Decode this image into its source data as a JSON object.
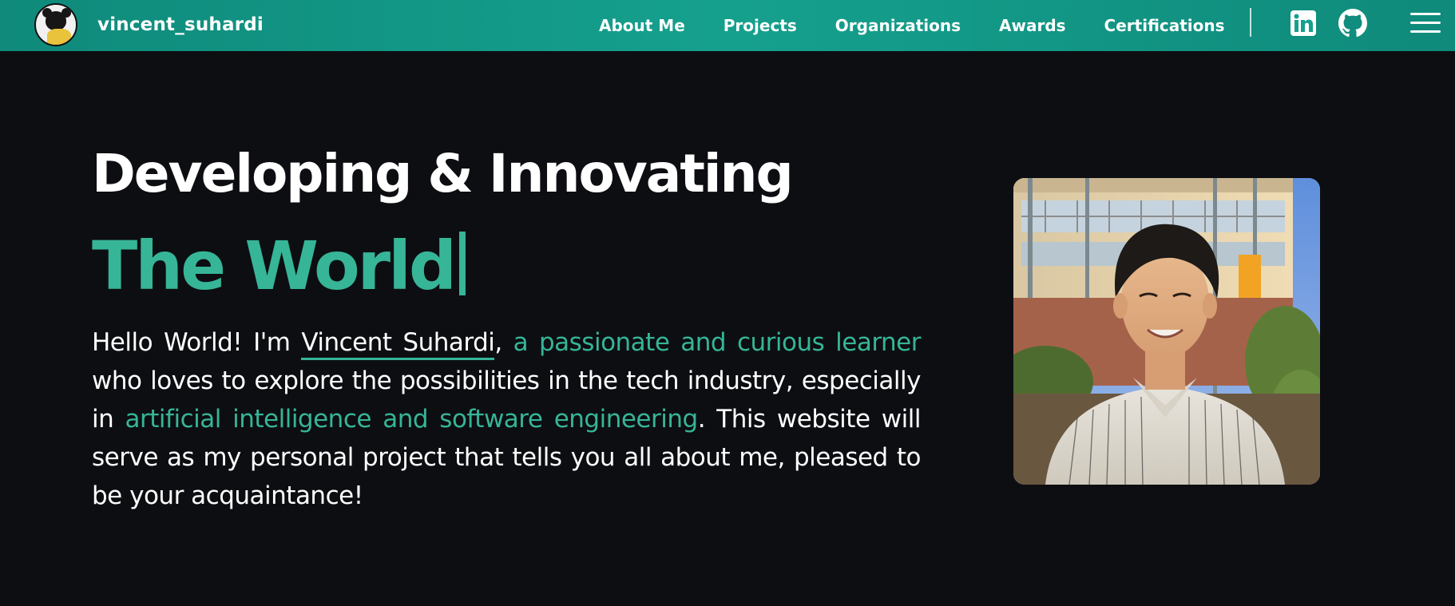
{
  "brand": {
    "name": "vincent_suhardi",
    "avatar_icon": "panda-avatar-icon"
  },
  "nav": {
    "links": [
      {
        "label": "About Me"
      },
      {
        "label": "Projects"
      },
      {
        "label": "Organizations"
      },
      {
        "label": "Awards"
      },
      {
        "label": "Certifications"
      }
    ],
    "social": {
      "linkedin_icon": "linkedin-icon",
      "github_icon": "github-icon"
    },
    "menu_icon": "hamburger-menu-icon"
  },
  "hero": {
    "title_line1": "Developing & Innovating",
    "title_line2": "The World",
    "intro": {
      "greeting": "Hello World! I'm ",
      "name": "Vincent Suhardi",
      "comma": ", ",
      "accent1": "a passionate and curious learner",
      "middle": " who loves to explore the possibilities in the tech industry, especially in ",
      "accent2": "artificial intelligence and software engineering",
      "ending": ". This website will serve as my personal project that tells you all about me, pleased to be your acquaintance!"
    }
  },
  "photo": {
    "description_icon": "profile-photo"
  },
  "colors": {
    "navbar": "#15a08d",
    "accent": "#36b597",
    "background": "#0d0e12",
    "text": "#ffffff"
  }
}
